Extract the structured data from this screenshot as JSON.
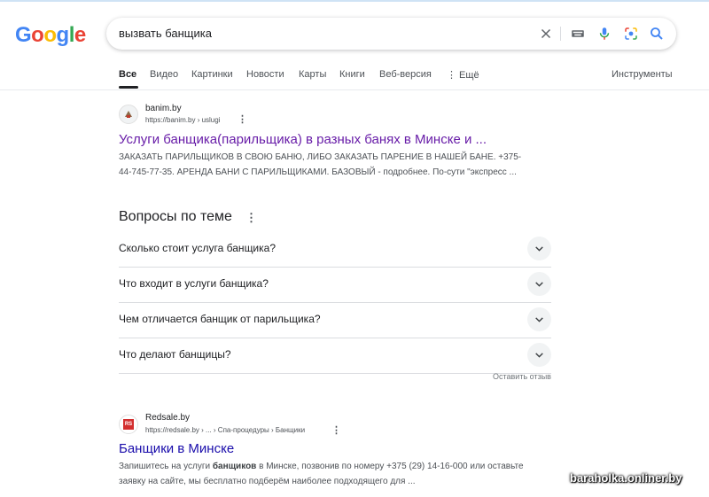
{
  "logo": {
    "letters": [
      "G",
      "o",
      "o",
      "g",
      "l",
      "e"
    ],
    "colors": [
      "#4285F4",
      "#EA4335",
      "#FBBC05",
      "#4285F4",
      "#34A853",
      "#EA4335"
    ]
  },
  "search": {
    "query": "вызвать банщика"
  },
  "tabs": [
    "Все",
    "Видео",
    "Картинки",
    "Новости",
    "Карты",
    "Книги",
    "Веб-версия",
    "⋮ Ещё"
  ],
  "tools_label": "Инструменты",
  "results": [
    {
      "site": "banim.by",
      "url": "https://banim.by › uslugi",
      "title": "Услуги банщика(парильщика) в разных банях в Минске и ...",
      "snippet_line1": "ЗАКАЗАТЬ ПАРИЛЬЩИКОВ В СВОЮ БАНЮ, ЛИБО ЗАКАЗАТЬ ПАРЕНИЕ В НАШЕЙ БАНЕ. +375-",
      "snippet_line2": "44-745-77-35. АРЕНДА БАНИ С ПАРИЛЬЩИКАМИ. БАЗОВЫЙ - подробнее. По-сути \"экспресс ..."
    },
    {
      "site": "Redsale.by",
      "url": "https://redsale.by › ... › Спа-процедуры › Банщики",
      "favicon_text": "RS",
      "title": "Банщики в Минске",
      "snippet_part1": "Запишитесь на услуги ",
      "snippet_bold": "банщиков",
      "snippet_part2": " в Минске, позвонив по номеру +375 (29) 14-16-000 или оставьте",
      "snippet_line2": "заявку на сайте, мы бесплатно подберём наиболее подходящего для ..."
    }
  ],
  "paa": {
    "heading": "Вопросы по теме",
    "questions": [
      "Сколько стоит услуга банщика?",
      "Что входит в услуги банщика?",
      "Чем отличается банщик от парильщика?",
      "Что делают банщицы?"
    ],
    "feedback": "Оставить отзыв"
  },
  "watermark": "baraholka.onliner.by"
}
